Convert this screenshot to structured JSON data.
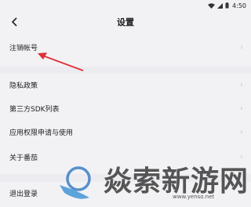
{
  "status_bar": {
    "time": "4:50"
  },
  "header": {
    "title": "设置"
  },
  "menu": {
    "deregister": "注销帐号",
    "privacy": "隐私政策",
    "sdk_list": "第三方SDK列表",
    "permissions": "应用权限申请与使用",
    "about": "关于番茄",
    "logout": "退出登录"
  },
  "icons": {
    "back": "back-icon",
    "chevron": "chevron-right-icon"
  },
  "colors": {
    "background": "#f2f2f5",
    "annotation_arrow": "#e0303a"
  },
  "watermark": {
    "text": "焱索新游网",
    "url": "www.yenso.net"
  }
}
